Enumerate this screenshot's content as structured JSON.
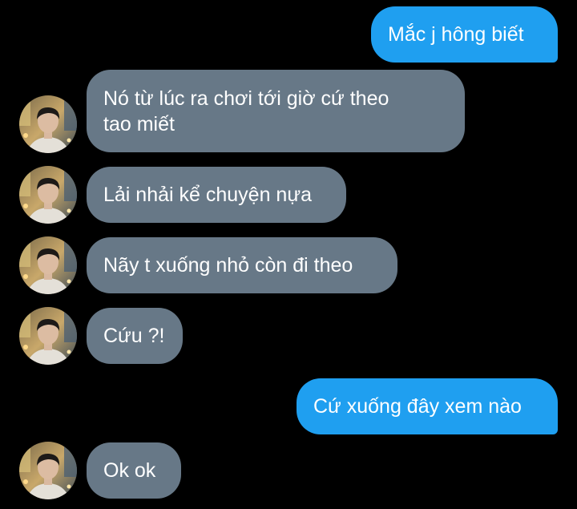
{
  "chat": {
    "contact_avatar_icon": "person-photo-avatar",
    "colors": {
      "background": "#000000",
      "incoming_bubble": "#677887",
      "outgoing_bubble": "#1f9ff0",
      "text": "#ffffff"
    },
    "messages": [
      {
        "direction": "outgoing",
        "text": "Mắc j hông biết"
      },
      {
        "direction": "incoming",
        "text": "Nó từ lúc ra chơi tới giờ cứ theo\ntao miết"
      },
      {
        "direction": "incoming",
        "text": "Lải nhải kể chuyện nựa"
      },
      {
        "direction": "incoming",
        "text": "Nãy t xuống nhỏ còn đi theo"
      },
      {
        "direction": "incoming",
        "text": "Cứu ?!"
      },
      {
        "direction": "outgoing",
        "text": "Cứ xuống đây xem nào"
      },
      {
        "direction": "incoming",
        "text": "Ok ok"
      }
    ]
  }
}
